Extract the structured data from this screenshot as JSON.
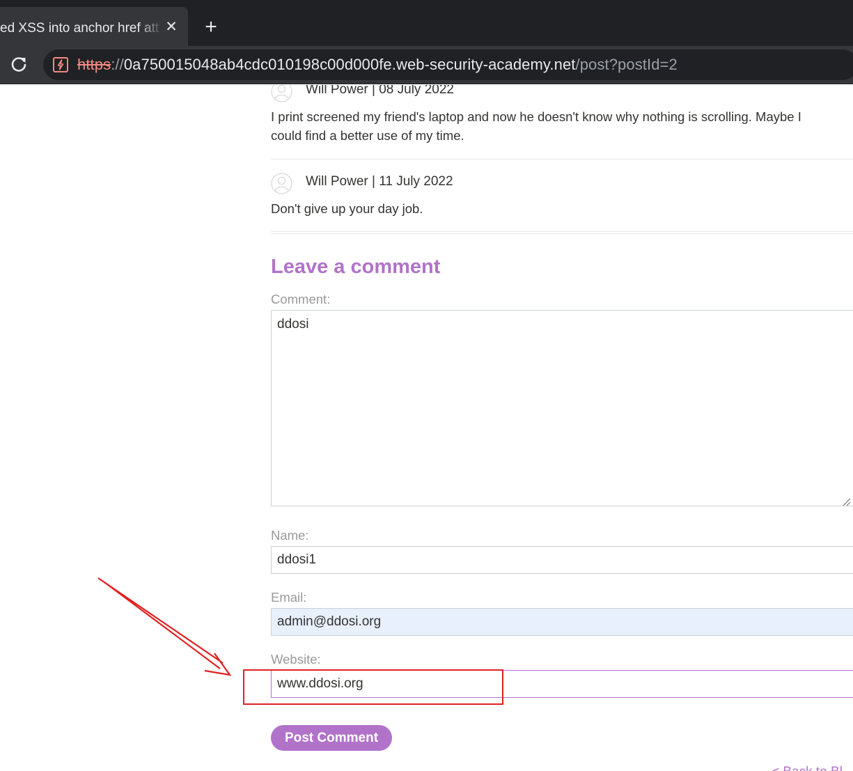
{
  "browser": {
    "tab_title": "ed XSS into anchor href att",
    "url_scheme": "https",
    "url_sep": "://",
    "url_host": "0a750015048ab4cdc010198c00d000fe.web-security-academy.net",
    "url_path": "/post?postId=2"
  },
  "comments": [
    {
      "meta": "Will Power | 08 July 2022",
      "text": "I print screened my friend's laptop and now he doesn't know why nothing is scrolling. Maybe I could find a better use of my time."
    },
    {
      "meta": "Will Power | 11 July 2022",
      "text": "Don't give up your day job."
    }
  ],
  "form": {
    "title": "Leave a comment",
    "comment_label": "Comment:",
    "comment_value": "ddosi",
    "name_label": "Name:",
    "name_value": "ddosi1",
    "email_label": "Email:",
    "email_value": "admin@ddosi.org",
    "website_label": "Website:",
    "website_value": "www.ddosi.org",
    "submit_label": "Post Comment"
  },
  "back_link": "< Back to Bl",
  "colors": {
    "accent": "#b073c9",
    "annotation": "#e02020"
  }
}
